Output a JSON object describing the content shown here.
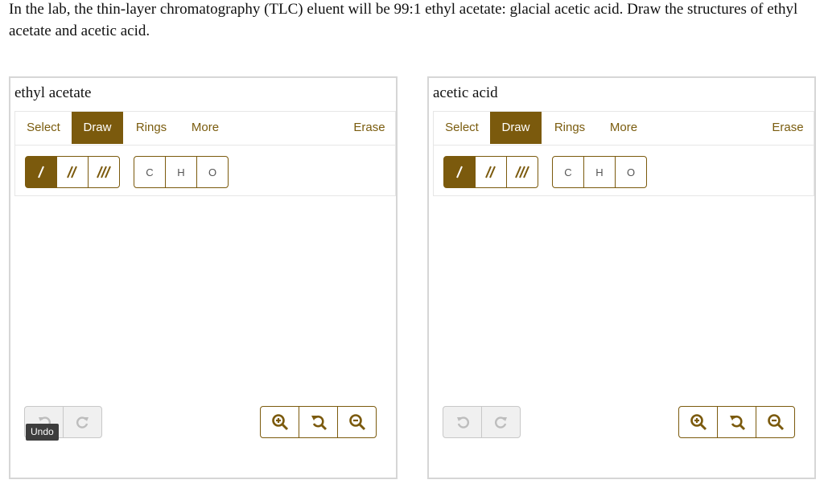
{
  "question": {
    "text": "In the lab, the thin-layer chromatography (TLC) eluent will be 99:1 ethyl acetate: glacial acetic acid. Draw the structures of ethyl acetate and acetic acid."
  },
  "panels": [
    {
      "title": "ethyl acetate",
      "tabs": {
        "select": "Select",
        "draw": "Draw",
        "rings": "Rings",
        "more": "More",
        "erase": "Erase"
      },
      "atoms": {
        "c": "C",
        "h": "H",
        "o": "O"
      },
      "tooltip": "Undo"
    },
    {
      "title": "acetic acid",
      "tabs": {
        "select": "Select",
        "draw": "Draw",
        "rings": "Rings",
        "more": "More",
        "erase": "Erase"
      },
      "atoms": {
        "c": "C",
        "h": "H",
        "o": "O"
      }
    }
  ],
  "colors": {
    "accent": "#7b5a0d",
    "disabled": "#c0c0c0"
  },
  "icons": [
    "single-bond-icon",
    "double-bond-icon",
    "triple-bond-icon",
    "undo-icon",
    "redo-icon",
    "zoom-in-icon",
    "zoom-reset-icon",
    "zoom-out-icon"
  ]
}
